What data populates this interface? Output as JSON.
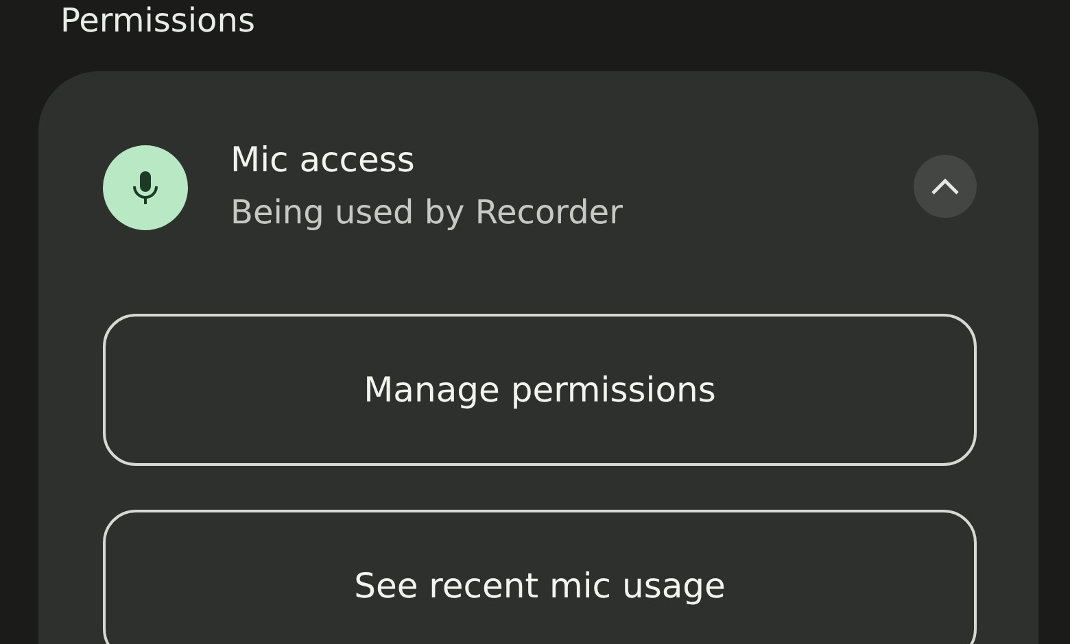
{
  "heading": "Permissions",
  "permission": {
    "title": "Mic access",
    "subtitle": "Being used by Recorder",
    "expanded": true
  },
  "buttons": [
    "Manage permissions",
    "See recent mic usage"
  ]
}
